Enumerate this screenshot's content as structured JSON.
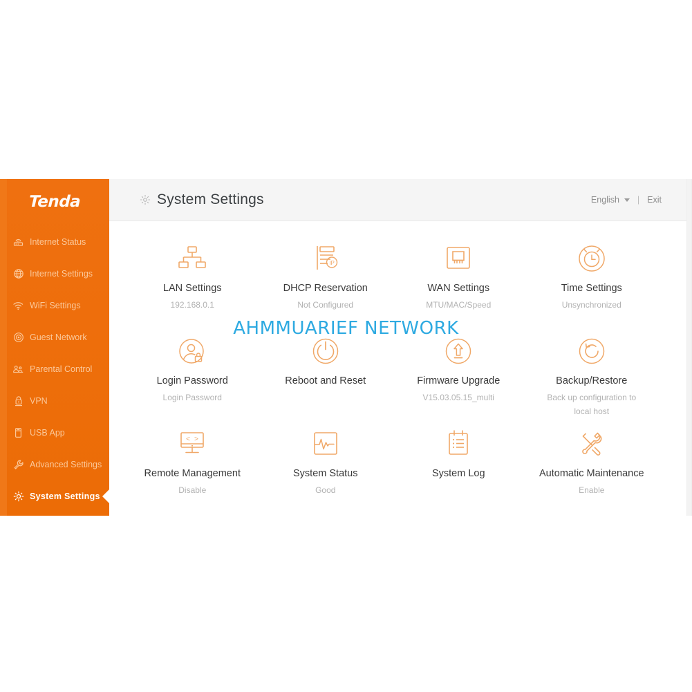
{
  "sidebar": {
    "brand": "Tenda",
    "items": [
      {
        "label": "Internet Status",
        "icon": "router-icon",
        "active": false
      },
      {
        "label": "Internet Settings",
        "icon": "globe-icon",
        "active": false
      },
      {
        "label": "WiFi Settings",
        "icon": "wifi-icon",
        "active": false
      },
      {
        "label": "Guest Network",
        "icon": "guest-network-icon",
        "active": false
      },
      {
        "label": "Parental Control",
        "icon": "parental-control-icon",
        "active": false
      },
      {
        "label": "VPN",
        "icon": "vpn-lock-icon",
        "active": false
      },
      {
        "label": "USB App",
        "icon": "usb-icon",
        "active": false
      },
      {
        "label": "Advanced Settings",
        "icon": "wrench-icon",
        "active": false
      },
      {
        "label": "System Settings",
        "icon": "gear-icon",
        "active": true
      }
    ]
  },
  "header": {
    "icon": "gear-icon",
    "title": "System Settings",
    "language": "English",
    "divider": "|",
    "exit": "Exit"
  },
  "main": {
    "tiles": [
      {
        "label": "LAN Settings",
        "sub": "192.168.0.1",
        "icon": "lan-topology-icon"
      },
      {
        "label": "DHCP Reservation",
        "sub": "Not Configured",
        "icon": "dhcp-ip-list-icon"
      },
      {
        "label": "WAN Settings",
        "sub": "MTU/MAC/Speed",
        "icon": "ethernet-port-icon"
      },
      {
        "label": "Time Settings",
        "sub": "Unsynchronized",
        "icon": "alarm-clock-icon"
      },
      {
        "label": "Login Password",
        "sub": "Login Password",
        "icon": "user-lock-icon"
      },
      {
        "label": "Reboot and Reset",
        "sub": "",
        "icon": "power-icon"
      },
      {
        "label": "Firmware Upgrade",
        "sub": "V15.03.05.15_multi",
        "icon": "upload-arrow-icon"
      },
      {
        "label": "Backup/Restore",
        "sub": "Back up configuration to local host",
        "icon": "restore-circle-icon"
      },
      {
        "label": "Remote Management",
        "sub": "Disable",
        "icon": "monitor-code-icon"
      },
      {
        "label": "System Status",
        "sub": "Good",
        "icon": "heartbeat-icon"
      },
      {
        "label": "System Log",
        "sub": "",
        "icon": "clipboard-list-icon"
      },
      {
        "label": "Automatic Maintenance",
        "sub": "Enable",
        "icon": "tools-icon"
      }
    ]
  },
  "watermark": {
    "text": "AHMMUARIEF NETWORK",
    "color": "#2eaae1"
  },
  "colors": {
    "brand_orange": "#ef6c00",
    "icon_orange": "#f0a868",
    "header_bg": "#f5f5f5",
    "sidebar_text": "#fbc89a",
    "sub_text": "#b2b2b2"
  }
}
